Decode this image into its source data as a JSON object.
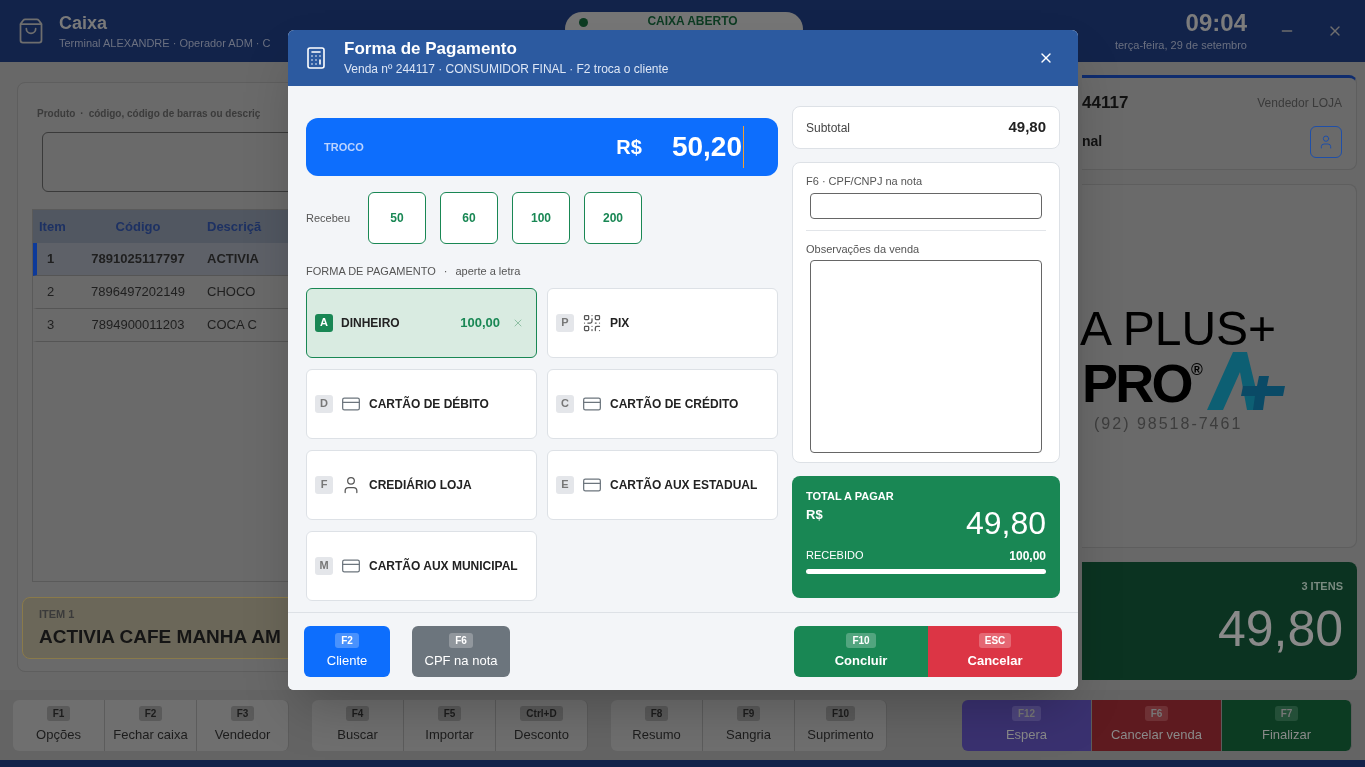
{
  "app_header": {
    "title": "Caixa",
    "subtitle": "Terminal ALEXANDRE · Operador ADM · C",
    "status": "CAIXA ABERTO",
    "time": "09:04",
    "date": "terça-feira, 29 de setembro"
  },
  "product_panel": {
    "label": "Produto",
    "separator": "·",
    "hint": "código, código de barras ou descriç",
    "table": {
      "columns": [
        "Item",
        "Código",
        "Descriçã"
      ],
      "rows": [
        {
          "cells": [
            "1",
            "7891025117797",
            "ACTIVIA"
          ],
          "selected": true
        },
        {
          "cells": [
            "2",
            "7896497202149",
            "CHOCO"
          ],
          "selected": false
        },
        {
          "cells": [
            "3",
            "7894900011203",
            "COCA C"
          ],
          "selected": false
        }
      ]
    },
    "current_item": {
      "label": "ITEM 1",
      "name": "ACTIVIA CAFE MANHA AM"
    }
  },
  "sale_panel": {
    "sale_number": "44117",
    "vendor": "Vendedor LOJA",
    "customer": "nal",
    "logo": {
      "line1": "A PLUS+",
      "line2": "PRO",
      "mark": "®",
      "phone": "(92) 98518-7461"
    },
    "total": {
      "count": "3 ITENS",
      "value": "49,80"
    }
  },
  "function_keys": [
    [
      {
        "key": "F1",
        "label": "Opções"
      },
      {
        "key": "F2",
        "label": "Fechar caixa"
      },
      {
        "key": "F3",
        "label": "Vendedor"
      }
    ],
    [
      {
        "key": "F4",
        "label": "Buscar"
      },
      {
        "key": "F5",
        "label": "Importar"
      },
      {
        "key": "Ctrl+D",
        "label": "Desconto"
      }
    ],
    [
      {
        "key": "F8",
        "label": "Resumo"
      },
      {
        "key": "F9",
        "label": "Sangria"
      },
      {
        "key": "F10",
        "label": "Suprimento"
      }
    ],
    [
      {
        "key": "F12",
        "label": "Espera",
        "color": "#3a3170"
      },
      {
        "key": "F6",
        "label": "Cancelar venda",
        "color": "#5e1a1f"
      },
      {
        "key": "F7",
        "label": "Finalizar",
        "color": "#0c3b22"
      }
    ]
  ],
  "dialog": {
    "title": "Forma de Pagamento",
    "subtitle": "Venda nº 244117 · CONSUMIDOR FINAL · F2 troca o cliente",
    "change": {
      "label": "TROCO",
      "currency": "R$",
      "value": "50,20"
    },
    "received_label": "Recebeu",
    "quick_amounts": [
      "50",
      "60",
      "100",
      "200"
    ],
    "methods_label": "FORMA DE PAGAMENTO",
    "methods_separator": "·",
    "methods_hint": "aperte a letra",
    "methods": [
      {
        "letter": "A",
        "label": "DINHEIRO",
        "kind": "cash",
        "amount": "100,00",
        "selected": true
      },
      {
        "letter": "P",
        "label": "PIX",
        "kind": "qr",
        "selected": false
      },
      {
        "letter": "D",
        "label": "CARTÃO DE DÉBITO",
        "kind": "card",
        "selected": false
      },
      {
        "letter": "C",
        "label": "CARTÃO DE CRÉDITO",
        "kind": "card",
        "selected": false
      },
      {
        "letter": "F",
        "label": "CREDIÁRIO LOJA",
        "kind": "person",
        "selected": false
      },
      {
        "letter": "E",
        "label": "CARTÃO AUX ESTADUAL",
        "kind": "card",
        "selected": false
      },
      {
        "letter": "M",
        "label": "CARTÃO AUX MUNICIPAL",
        "kind": "card",
        "selected": false
      }
    ],
    "subtotal": {
      "label": "Subtotal",
      "value": "49,80"
    },
    "cpf_label": "F6 · CPF/CNPJ na nota",
    "notes_label": "Observações da venda",
    "total": {
      "label": "TOTAL A PAGAR",
      "currency": "R$",
      "value": "49,80",
      "received_label": "RECEBIDO",
      "received": "100,00",
      "level": 1
    },
    "footer_left": [
      {
        "key": "F2",
        "label": "Cliente",
        "kind": "primary"
      },
      {
        "key": "F6",
        "label": "CPF na nota",
        "kind": "secondary"
      }
    ],
    "footer_right": [
      {
        "key": "F10",
        "label": "Concluir",
        "kind": "success"
      },
      {
        "key": "ESC",
        "label": "Cancelar",
        "kind": "danger"
      }
    ]
  }
}
